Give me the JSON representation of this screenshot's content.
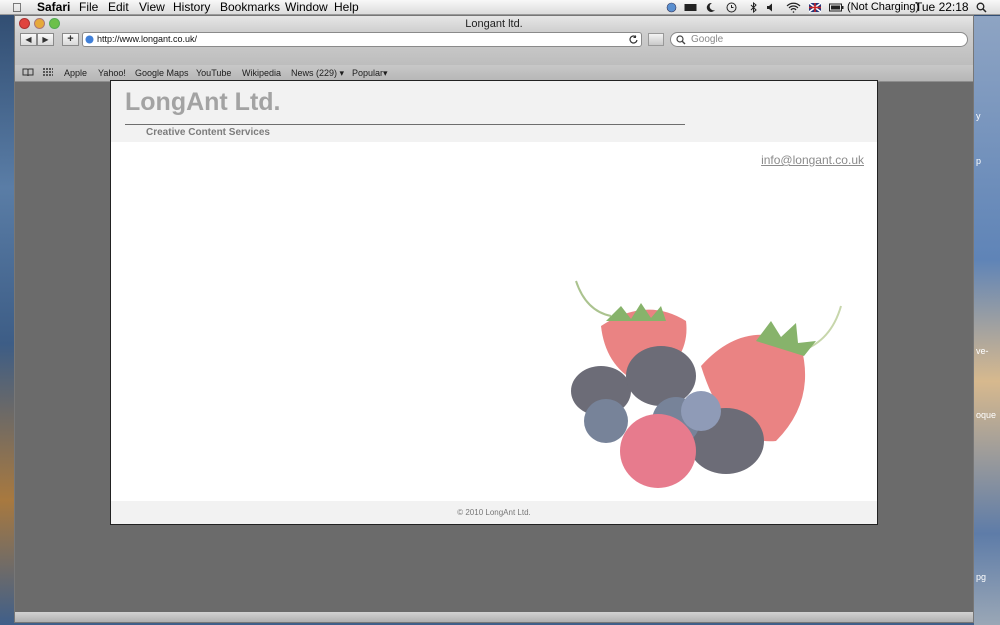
{
  "menubar": {
    "app": "Safari",
    "menus": [
      "File",
      "Edit",
      "View",
      "History",
      "Bookmarks",
      "Window",
      "Help"
    ],
    "battery_status": "(Not Charging)",
    "clock": "Tue 22:18"
  },
  "window": {
    "title": "Longant ltd.",
    "url": "http://www.longant.co.uk/",
    "search_placeholder": "Google"
  },
  "bookmarks": [
    "Apple",
    "Yahoo!",
    "Google Maps",
    "YouTube",
    "Wikipedia",
    "News (229)",
    "Popular"
  ],
  "desktop_fragments": [
    "y",
    "p",
    "ve-",
    "oque",
    "pg"
  ],
  "page": {
    "site_title": "LongAnt Ltd.",
    "tagline": "Creative Content Services",
    "email": "info@longant.co.uk",
    "footer": "© 2010 LongAnt Ltd."
  },
  "colors": {
    "window_gray": "#6b6b6b",
    "title_gray": "#a3a3a3",
    "strawberry": "#e35a5a",
    "blackberry": "#3b3b4a",
    "blueberry": "#4a5a78"
  }
}
